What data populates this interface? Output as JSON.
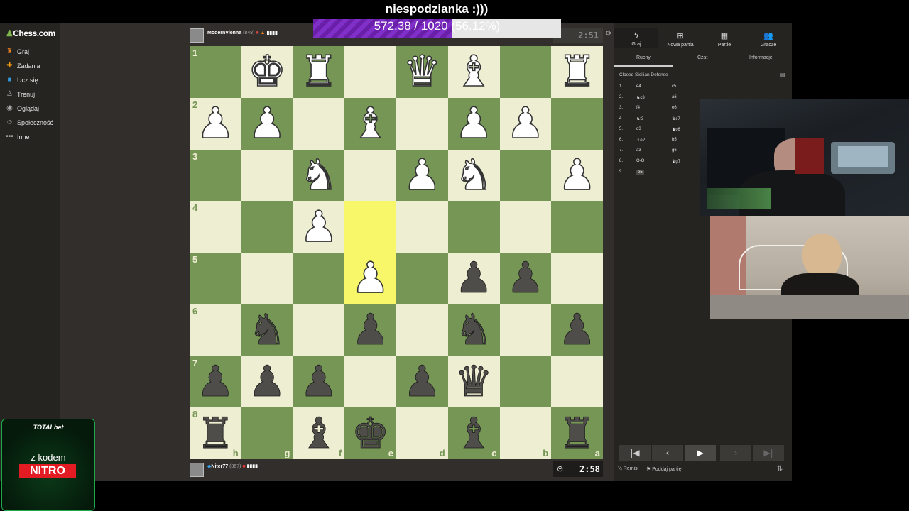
{
  "stream": {
    "caption": "niespodzianka :)))",
    "progress_text": "572.38 / 1020 (56.12%)",
    "progress_fraction": 0.5612
  },
  "sidebar": {
    "logo": "Chess.com",
    "items": [
      {
        "label": "Graj",
        "icon": "play-icon"
      },
      {
        "label": "Zadania",
        "icon": "puzzle-icon"
      },
      {
        "label": "Ucz się",
        "icon": "learn-icon"
      },
      {
        "label": "Trenuj",
        "icon": "train-icon"
      },
      {
        "label": "Oglądaj",
        "icon": "watch-icon"
      },
      {
        "label": "Społeczność",
        "icon": "community-icon"
      },
      {
        "label": "Inne",
        "icon": "more-icon"
      }
    ]
  },
  "players": {
    "top": {
      "name": "ModernVienna",
      "rating": "(848)",
      "clock": "2:51"
    },
    "bottom": {
      "name": "Niter77",
      "rating": "(867)",
      "clock": "2:58"
    }
  },
  "board": {
    "ranks": [
      "1",
      "2",
      "3",
      "4",
      "5",
      "6",
      "7",
      "8"
    ],
    "files": [
      "h",
      "g",
      "f",
      "e",
      "d",
      "c",
      "b",
      "a"
    ],
    "rows": [
      [
        "",
        "wK",
        "wR",
        "",
        "wQ",
        "wB",
        "",
        "wR"
      ],
      [
        "wP",
        "wP",
        "",
        "wB",
        "",
        "wP",
        "wP",
        ""
      ],
      [
        "",
        "",
        "wN",
        "",
        "wP",
        "wN",
        "",
        "wP"
      ],
      [
        "",
        "",
        "wP",
        "",
        "",
        "",
        "",
        ""
      ],
      [
        "",
        "",
        "",
        "wP",
        "",
        "bP",
        "bP",
        ""
      ],
      [
        "",
        "bN",
        "",
        "bP",
        "",
        "bN",
        "",
        "bP"
      ],
      [
        "bP",
        "bP",
        "bP",
        "",
        "bP",
        "bQ",
        "",
        ""
      ],
      [
        "bR",
        "",
        "bB",
        "bK",
        "",
        "bB",
        "",
        "bR"
      ]
    ],
    "highlight": [
      [
        3,
        3
      ],
      [
        4,
        3
      ]
    ],
    "colors": {
      "light": "#eeeed2",
      "dark": "#769656",
      "highlight": "#f7f769"
    }
  },
  "right_panel": {
    "top_tabs": [
      {
        "label": "Graj",
        "icon": "lightning-icon"
      },
      {
        "label": "Nowa partia",
        "icon": "plus-icon"
      },
      {
        "label": "Partie",
        "icon": "board-icon"
      },
      {
        "label": "Gracze",
        "icon": "players-icon"
      }
    ],
    "sub_tabs": [
      "Ruchy",
      "Czat",
      "Informacje"
    ],
    "opening": "Closed Sicilian Defense",
    "moves": [
      {
        "n": "1.",
        "w": "e4",
        "b": "c5"
      },
      {
        "n": "2.",
        "w": "♞c3",
        "b": "a6"
      },
      {
        "n": "3.",
        "w": "f4",
        "b": "e6"
      },
      {
        "n": "4.",
        "w": "♞f3",
        "b": "♛c7"
      },
      {
        "n": "5.",
        "w": "d3",
        "b": "♞c6"
      },
      {
        "n": "6.",
        "w": "♝e2",
        "b": "b5"
      },
      {
        "n": "7.",
        "w": "a3",
        "b": "g6"
      },
      {
        "n": "8.",
        "w": "O-O",
        "b": "♝g7"
      },
      {
        "n": "9.",
        "w": "e5",
        "b": ""
      }
    ],
    "draw_label": "Remis",
    "resign_label": "Poddaj partię",
    "draw_symbol": "½"
  },
  "promo": {
    "brand": "TOTALbet",
    "line1": "z kodem",
    "line2": "NITRO"
  }
}
